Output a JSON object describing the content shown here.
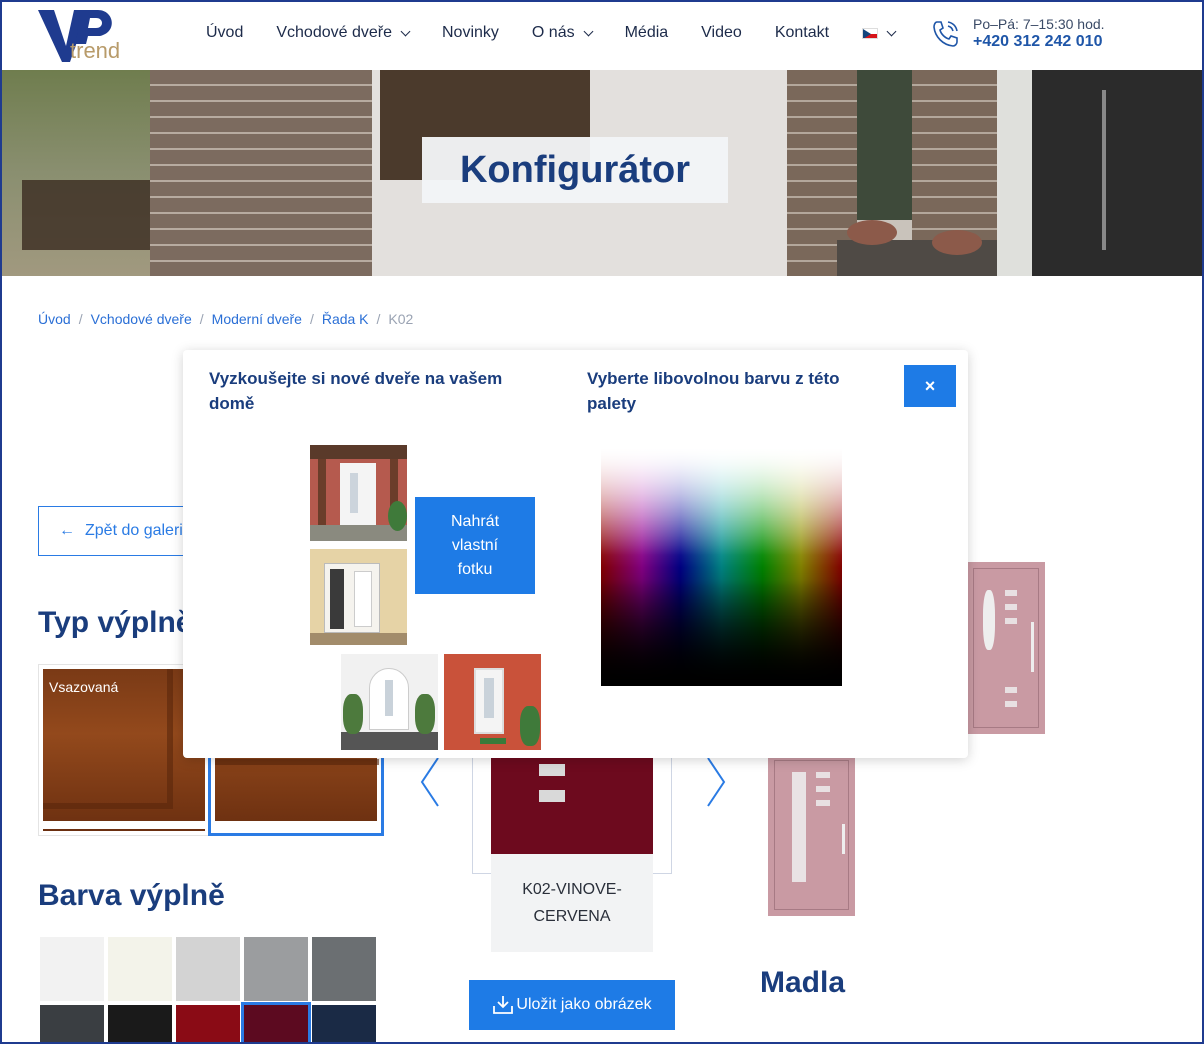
{
  "header": {
    "logo_text": "trend",
    "nav": [
      {
        "label": "Úvod",
        "has_dropdown": false
      },
      {
        "label": "Vchodové dveře",
        "has_dropdown": true
      },
      {
        "label": "Novinky",
        "has_dropdown": false
      },
      {
        "label": "O nás",
        "has_dropdown": true
      },
      {
        "label": "Média",
        "has_dropdown": false
      },
      {
        "label": "Video",
        "has_dropdown": false
      },
      {
        "label": "Kontakt",
        "has_dropdown": false
      }
    ],
    "language": "cs",
    "hours": "Po–Pá: 7–15:30 hod.",
    "phone": "+420 312 242 010"
  },
  "hero": {
    "title": "Konfigurátor"
  },
  "breadcrumb": {
    "items": [
      "Úvod",
      "Vchodové dveře",
      "Moderní dveře",
      "Řada K"
    ],
    "current": "K02"
  },
  "page": {
    "back_label": "Zpět do galerie",
    "fill_type_heading": "Typ výplně",
    "fill_type_options": [
      "Vsazovaná"
    ],
    "fill_color_heading": "Barva výplně",
    "swatches": [
      "#f2f2f2",
      "#f3f3ea",
      "#d3d3d3",
      "#9b9d9f",
      "#6b6f72",
      "#3a3e42",
      "#1a1a1a",
      "#8a0b15",
      "#5c0a20",
      "#1a2a45"
    ],
    "selected_swatch": 8,
    "door_label": "K02-VINOVE-CERVENA",
    "save_label": "Uložit jako obrázek",
    "handles_heading": "Madla"
  },
  "modal": {
    "left_title": "Vyzkoušejte si nové dveře na vašem domě",
    "right_title": "Vyberte libovolnou barvu z této palety",
    "upload_label": "Nahrát vlastní fotku",
    "close_label": "×"
  },
  "colors": {
    "accent": "#1e7be6",
    "heading": "#1a3d7d",
    "link": "#2a6fd6"
  }
}
